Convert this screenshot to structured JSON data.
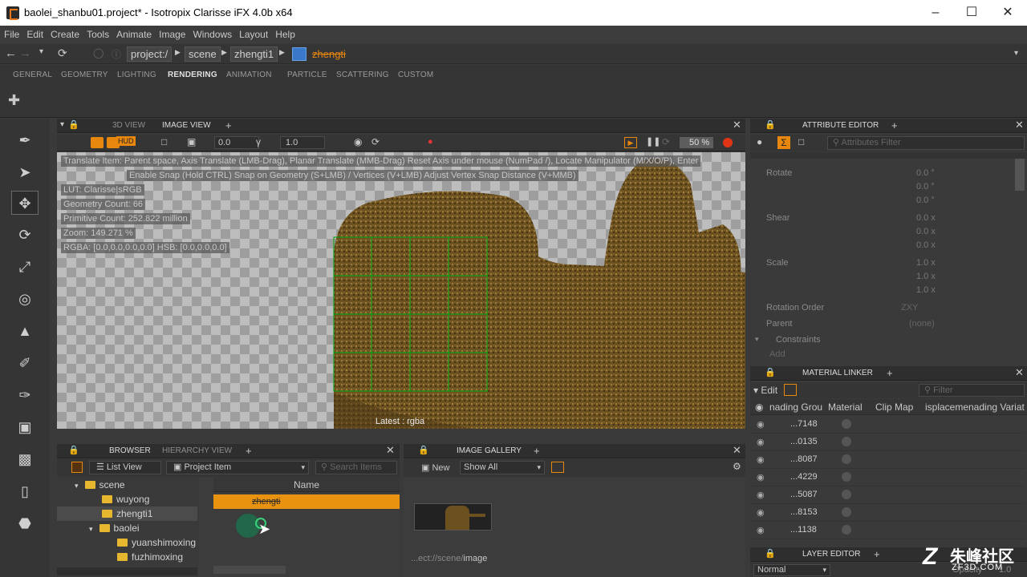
{
  "window": {
    "title": "baolei_shanbu01.project* - Isotropix Clarisse iFX 4.0b x64"
  },
  "menu": [
    "File",
    "Edit",
    "Create",
    "Tools",
    "Animate",
    "Image",
    "Windows",
    "Layout",
    "Help"
  ],
  "address": {
    "crumbs": [
      "project:/",
      "scene",
      "zhengti1"
    ],
    "current": "zhengti"
  },
  "shelf_tabs": [
    "GENERAL",
    "GEOMETRY",
    "LIGHTING",
    "RENDERING",
    "ANIMATION",
    "PARTICLE",
    "SCATTERING",
    "CUSTOM"
  ],
  "viewer": {
    "tabs": [
      "3D VIEW",
      "IMAGE VIEW"
    ],
    "toolbar": {
      "exposure": "0.0",
      "gamma": "1.0",
      "zoom": "50",
      "zoom_unit": "%"
    },
    "hints": [
      "Translate Item: Parent space, Axis Translate (LMB-Drag), Planar Translate (MMB-Drag) Reset Axis under mouse (NumPad /), Locate Manipulator (M/X/O/P), Enter",
      "Enable Snap (Hold CTRL) Snap on Geometry (S+LMB) / Vertices (V+LMB) Adjust Vertex Snap Distance (V+MMB)"
    ],
    "info": [
      "LUT: Clarisse|sRGB",
      "Geometry Count: 66",
      "Primitive Count: 252.822 million",
      "Zoom: 149.271 %",
      "RGBA: [0.0,0.0,0.0,0.0] HSB: [0.0,0.0,0.0]"
    ],
    "status": "Latest : rgba"
  },
  "browser": {
    "tabs": [
      "BROWSER",
      "HIERARCHY VIEW"
    ],
    "view_mode": "List View",
    "filter": "Project Item",
    "search_placeholder": "Search Items",
    "column_name": "Name",
    "tree": [
      "scene",
      "wuyong",
      "zhengti1",
      "baolei",
      "yuanshimoxing",
      "fuzhimoxing"
    ],
    "selected_item": "zhengti"
  },
  "gallery": {
    "title": "IMAGE GALLERY",
    "new_label": "New",
    "show": "Show All",
    "path_prefix": "...ect://scene/",
    "path_tail": "image"
  },
  "attribute_editor": {
    "title": "ATTRIBUTE EDITOR",
    "filter_placeholder": "Attributes Filter",
    "rotate_label": "Rotate",
    "rotate": [
      "0.0 °",
      "0.0 °",
      "0.0 °"
    ],
    "shear_label": "Shear",
    "shear": [
      "0.0 x",
      "0.0 x",
      "0.0 x"
    ],
    "scale_label": "Scale",
    "scale": [
      "1.0 x",
      "1.0 x",
      "1.0 x"
    ],
    "rotation_order_label": "Rotation Order",
    "rotation_order": "ZXY",
    "parent_label": "Parent",
    "parent": "(none)",
    "constraints_label": "Constraints",
    "add_label": "Add"
  },
  "material_linker": {
    "title": "MATERIAL LINKER",
    "edit_label": "Edit",
    "filter_placeholder": "Filter",
    "columns": [
      "nading Grou",
      "Material",
      "Clip Map",
      "isplaceme",
      "nading Variat"
    ],
    "rows": [
      "...7148",
      "...0135",
      "...8087",
      "...4229",
      "...5087",
      "...8153",
      "...1138"
    ]
  },
  "layer_editor": {
    "title": "LAYER EDITOR",
    "mode": "Normal",
    "opacity_label": "Opacity",
    "opacity": "1.0"
  },
  "watermark": {
    "text": "朱峰社区",
    "url": "ZF3D.COM"
  },
  "colors": {
    "accent": "#e8870e",
    "selection": "#e8920f",
    "grid": "#1aa31a"
  }
}
